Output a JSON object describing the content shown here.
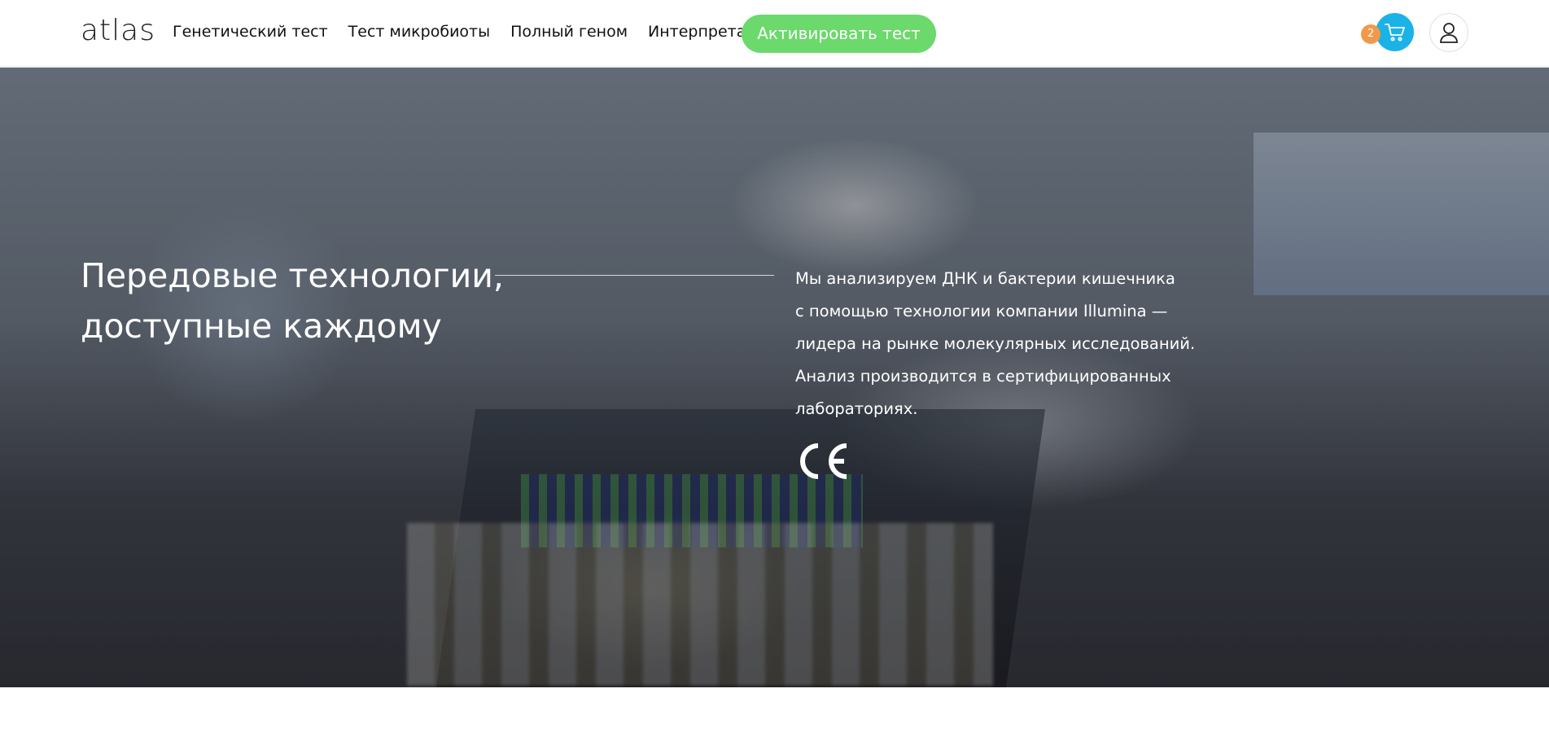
{
  "header": {
    "logo": "atlas",
    "nav": [
      {
        "label": "Генетический тест"
      },
      {
        "label": "Тест микробиоты"
      },
      {
        "label": "Полный геном"
      },
      {
        "label": "Интерпретация"
      }
    ],
    "activate_label": "Активировать тест",
    "cart_count": "2",
    "cart_icon": "cart-icon",
    "profile_icon": "user-icon"
  },
  "hero": {
    "title_line1": "Передовые технологии,",
    "title_line2": "доступные каждому",
    "text_lines": [
      "Мы анализируем ДНК и бактерии кишечника",
      "с помощью технологии компании Illumina —",
      "лидера на рынке молекулярных исследований.",
      "Анализ производится в сертифицированных",
      "лабораториях."
    ],
    "ce_mark_icon": "ce-mark-icon"
  },
  "colors": {
    "accent_green": "#6bd96b",
    "cart_blue": "#1bb2e6",
    "badge_orange": "#f2984a"
  }
}
